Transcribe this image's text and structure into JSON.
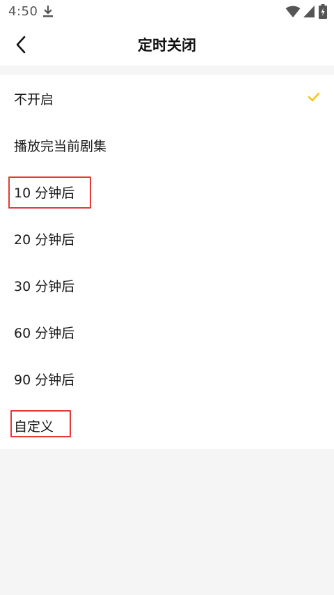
{
  "status_bar": {
    "time": "4:50",
    "icons": [
      "download-icon",
      "wifi-icon",
      "signal-icon",
      "battery-icon"
    ]
  },
  "header": {
    "back_icon": "chevron-left-icon",
    "title": "定时关闭"
  },
  "options": [
    {
      "label": "不开启",
      "selected": true
    },
    {
      "label": "播放完当前剧集",
      "selected": false
    },
    {
      "label": "10 分钟后",
      "selected": false,
      "highlighted": true
    },
    {
      "label": "20 分钟后",
      "selected": false
    },
    {
      "label": "30 分钟后",
      "selected": false
    },
    {
      "label": "60 分钟后",
      "selected": false
    },
    {
      "label": "90 分钟后",
      "selected": false
    },
    {
      "label": "自定义",
      "selected": false,
      "highlighted": true
    }
  ],
  "colors": {
    "accent_check": "#f5c518",
    "highlight_border": "#e53935",
    "background": "#f5f5f5"
  }
}
